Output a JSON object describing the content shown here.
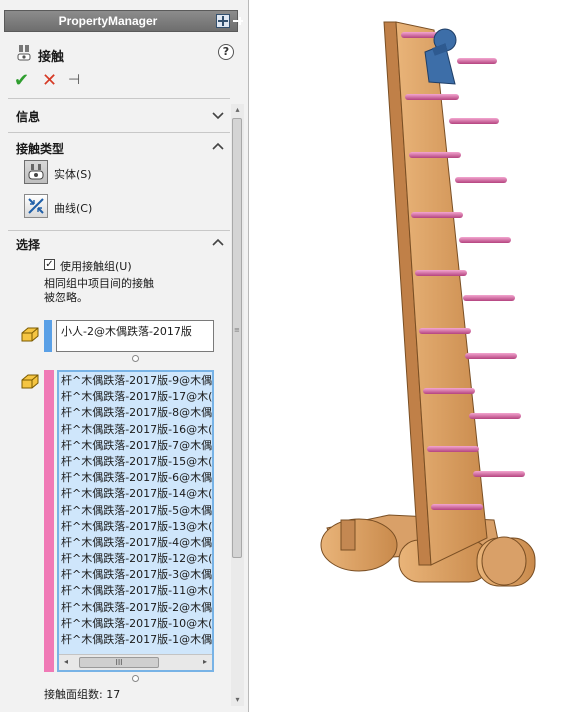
{
  "panel": {
    "header_title": "PropertyManager",
    "feature_title": "接触",
    "help": "?",
    "ok": "✔",
    "cancel": "✕",
    "pin": "⊣",
    "sections": {
      "info": "信息",
      "contact_type": "接触类型",
      "selection": "选择"
    },
    "contact_types": [
      {
        "label": "实体(S)",
        "selected": true,
        "icon": "solid-contact-icon"
      },
      {
        "label": "曲线(C)",
        "selected": false,
        "icon": "curve-contact-icon"
      }
    ],
    "use_contact_groups": {
      "label": "使用接触组(U)",
      "checked": true,
      "check_mark": "✓"
    },
    "note_line1": "相同组中项目间的接触",
    "note_line2": "被忽略。",
    "group1": {
      "color": "#5aa0e6",
      "items": [
        "小人-2@木偶跌落-2017版"
      ]
    },
    "group2": {
      "color": "#f07ab6",
      "items": [
        "杆^木偶跌落-2017版-9@木偶",
        "杆^木偶跌落-2017版-17@木(",
        "杆^木偶跌落-2017版-8@木偶",
        "杆^木偶跌落-2017版-16@木(",
        "杆^木偶跌落-2017版-7@木偶",
        "杆^木偶跌落-2017版-15@木(",
        "杆^木偶跌落-2017版-6@木偶",
        "杆^木偶跌落-2017版-14@木(",
        "杆^木偶跌落-2017版-5@木偶",
        "杆^木偶跌落-2017版-13@木(",
        "杆^木偶跌落-2017版-4@木偶",
        "杆^木偶跌落-2017版-12@木(",
        "杆^木偶跌落-2017版-3@木偶",
        "杆^木偶跌落-2017版-11@木(",
        "杆^木偶跌落-2017版-2@木偶",
        "杆^木偶跌落-2017版-10@木(",
        "杆^木偶跌落-2017版-1@木偶"
      ]
    },
    "hscroll_grip": "III",
    "scroll_left": "◂",
    "scroll_right": "▸",
    "scroll_up": "▴",
    "scroll_down": "▾",
    "count_label": "接触面组数: 17"
  },
  "icons": {
    "header_split": "split-panel-icon",
    "header_pin": "pin-icon",
    "feature": "contact-feature-icon",
    "selection1": "face-selection-icon",
    "selection2": "face-selection-icon"
  },
  "colors": {
    "wood": "#d89a5a",
    "rod": "#d96aa6",
    "figure": "#3d6ea8",
    "ok": "#2f9e2f",
    "cancel": "#d63a25"
  }
}
